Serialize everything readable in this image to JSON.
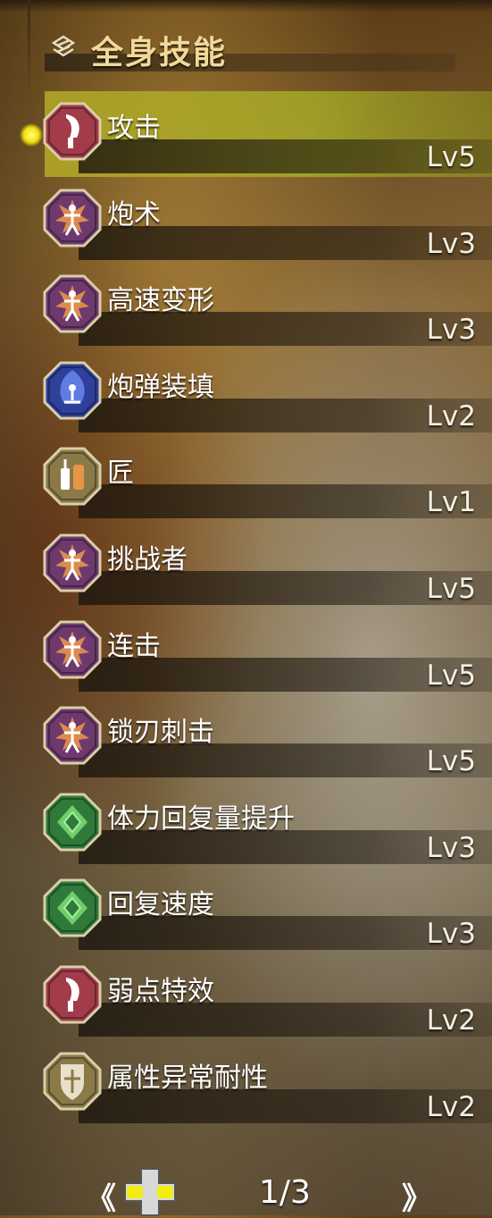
{
  "header": {
    "title": "全身技能",
    "icon": "armor-set-icon"
  },
  "colors": {
    "title": "#f0d99a",
    "selected_highlight": "#b4aa28",
    "text": "#ffffff"
  },
  "skills": [
    {
      "name": "攻击",
      "level": "Lv5",
      "icon": "blade-icon",
      "icon_color": "#a23c4a",
      "selected": true
    },
    {
      "name": "炮术",
      "level": "Lv3",
      "icon": "figure-burst-icon",
      "icon_color": "#6e3a6e",
      "selected": false
    },
    {
      "name": "高速变形",
      "level": "Lv3",
      "icon": "figure-burst-icon",
      "icon_color": "#6e3a6e",
      "selected": false
    },
    {
      "name": "炮弹装填",
      "level": "Lv2",
      "icon": "flame-figure-icon",
      "icon_color": "#2f3f9a",
      "selected": false
    },
    {
      "name": "匠",
      "level": "Lv1",
      "icon": "whetstone-icon",
      "icon_color": "#8a7a48",
      "selected": false
    },
    {
      "name": "挑战者",
      "level": "Lv5",
      "icon": "figure-burst-icon",
      "icon_color": "#6e3a6e",
      "selected": false
    },
    {
      "name": "连击",
      "level": "Lv5",
      "icon": "figure-burst-icon",
      "icon_color": "#6e3a6e",
      "selected": false
    },
    {
      "name": "锁刃刺击",
      "level": "Lv5",
      "icon": "figure-burst-icon",
      "icon_color": "#6e3a6e",
      "selected": false
    },
    {
      "name": "体力回复量提升",
      "level": "Lv3",
      "icon": "gem-icon",
      "icon_color": "#2f7a3a",
      "selected": false
    },
    {
      "name": "回复速度",
      "level": "Lv3",
      "icon": "gem-icon",
      "icon_color": "#2f7a3a",
      "selected": false
    },
    {
      "name": "弱点特效",
      "level": "Lv2",
      "icon": "blade-icon",
      "icon_color": "#a23c4a",
      "selected": false
    },
    {
      "name": "属性异常耐性",
      "level": "Lv2",
      "icon": "shield-icon",
      "icon_color": "#8a7a48",
      "selected": false
    }
  ],
  "footer": {
    "prev": "《",
    "next": "》",
    "page": "1/3",
    "dpad_icon": "dpad-icon"
  }
}
